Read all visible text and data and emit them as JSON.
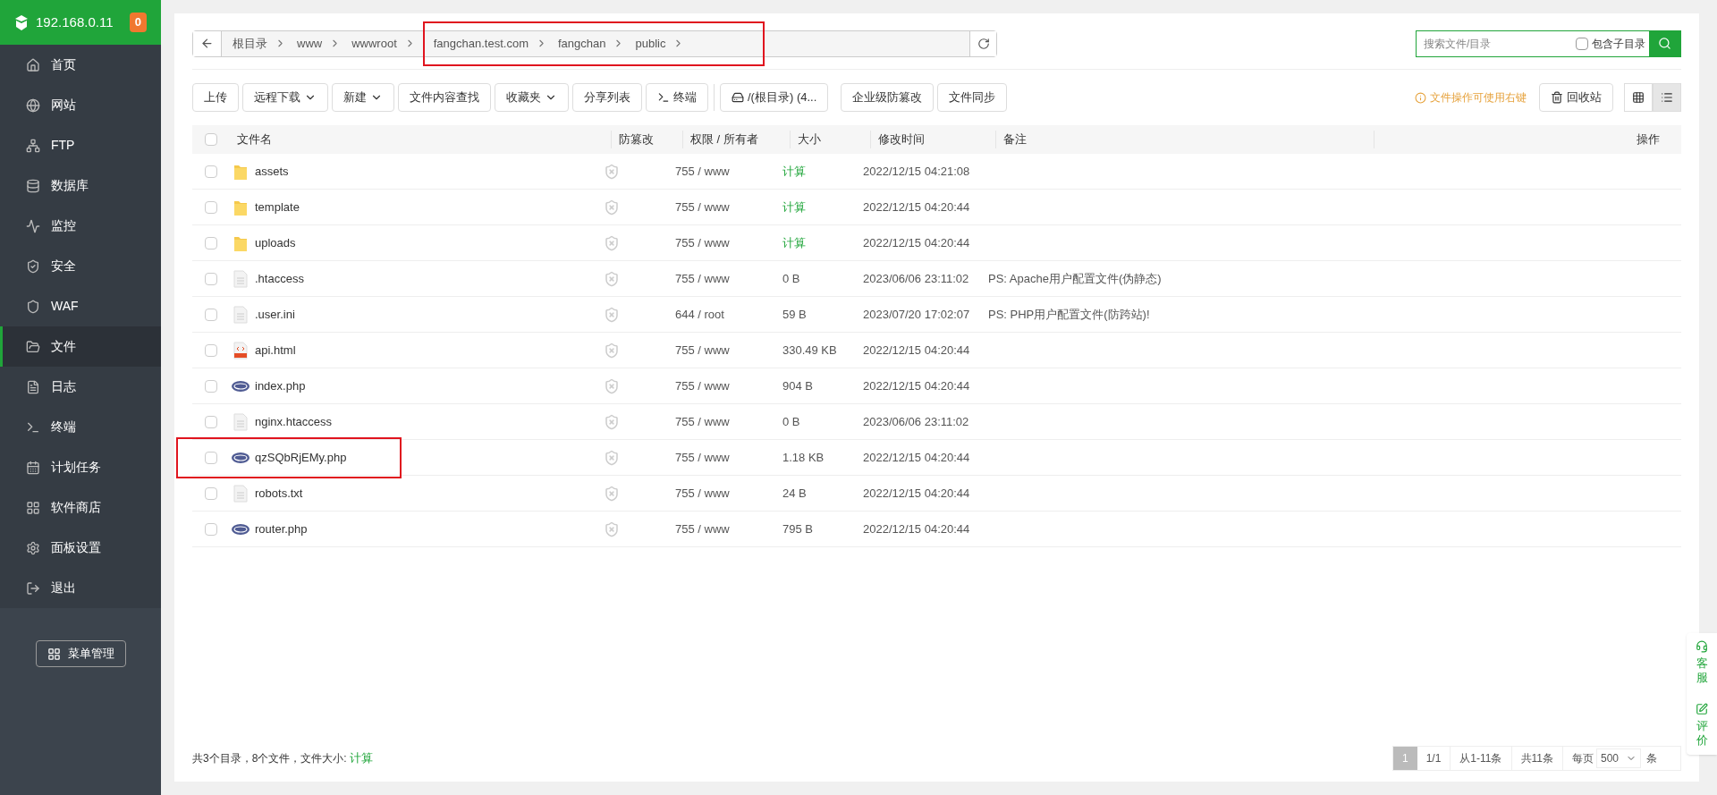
{
  "sidebar": {
    "host": "192.168.0.11",
    "badge": "0",
    "items": [
      {
        "label": "首页",
        "selected": false
      },
      {
        "label": "网站",
        "selected": false
      },
      {
        "label": "FTP",
        "selected": false
      },
      {
        "label": "数据库",
        "selected": false
      },
      {
        "label": "监控",
        "selected": false
      },
      {
        "label": "安全",
        "selected": false
      },
      {
        "label": "WAF",
        "selected": false
      },
      {
        "label": "文件",
        "selected": true
      },
      {
        "label": "日志",
        "selected": false
      },
      {
        "label": "终端",
        "selected": false
      },
      {
        "label": "计划任务",
        "selected": false
      },
      {
        "label": "软件商店",
        "selected": false
      },
      {
        "label": "面板设置",
        "selected": false
      },
      {
        "label": "退出",
        "selected": false
      }
    ],
    "menu_button": "菜单管理"
  },
  "breadcrumb": [
    {
      "label": "根目录",
      "highlighted": false
    },
    {
      "label": "www",
      "highlighted": false
    },
    {
      "label": "wwwroot",
      "highlighted": false
    },
    {
      "label": "fangchan.test.com",
      "highlighted": true
    },
    {
      "label": "fangchan",
      "highlighted": true
    },
    {
      "label": "public",
      "highlighted": true
    }
  ],
  "search": {
    "placeholder": "搜索文件/目录",
    "subdir_label": "包含子目录",
    "subdir_checked": false
  },
  "toolbar": [
    {
      "label": "上传",
      "kind": "plain"
    },
    {
      "label": "远程下载",
      "kind": "dropdown"
    },
    {
      "label": "新建",
      "kind": "dropdown"
    },
    {
      "label": "文件内容查找",
      "kind": "plain"
    },
    {
      "label": "收藏夹",
      "kind": "dropdown"
    },
    {
      "label": "分享列表",
      "kind": "plain"
    },
    {
      "label": "终端",
      "kind": "terminal"
    },
    {
      "label": "/(根目录) (4...",
      "kind": "disk"
    },
    {
      "label": "企业级防篡改",
      "kind": "plain"
    },
    {
      "label": "文件同步",
      "kind": "plain"
    }
  ],
  "hint": "文件操作可使用右键",
  "recycle": "回收站",
  "view_modes": [
    {
      "kind": "grid",
      "selected": false
    },
    {
      "kind": "list",
      "selected": true
    }
  ],
  "table": {
    "all_checked": false,
    "columns": [
      "文件名",
      "防篡改",
      "权限 / 所有者",
      "大小",
      "修改时间",
      "备注",
      "操作"
    ],
    "rows": [
      {
        "kind": "folder",
        "name": "assets",
        "perm": "755 / www",
        "size": "计算",
        "size_link": true,
        "mtime": "2022/12/15 04:21:08",
        "checked": false,
        "highlighted": false
      },
      {
        "kind": "folder",
        "name": "template",
        "perm": "755 / www",
        "size": "计算",
        "size_link": true,
        "mtime": "2022/12/15 04:20:44",
        "checked": false,
        "highlighted": false
      },
      {
        "kind": "folder",
        "name": "uploads",
        "perm": "755 / www",
        "size": "计算",
        "size_link": true,
        "mtime": "2022/12/15 04:20:44",
        "checked": false,
        "highlighted": false
      },
      {
        "kind": "file",
        "name": ".htaccess",
        "perm": "755 / www",
        "size": "0 B",
        "size_link": false,
        "mtime": "2023/06/06 23:11:02",
        "note": "PS: Apache用户配置文件(伪静态)",
        "checked": false,
        "highlighted": false
      },
      {
        "kind": "file",
        "name": ".user.ini",
        "perm": "644 / root",
        "size": "59 B",
        "size_link": false,
        "mtime": "2023/07/20 17:02:07",
        "note": "PS: PHP用户配置文件(防跨站)!",
        "checked": false,
        "highlighted": false
      },
      {
        "kind": "html",
        "name": "api.html",
        "perm": "755 / www",
        "size": "330.49 KB",
        "size_link": false,
        "mtime": "2022/12/15 04:20:44",
        "checked": false,
        "highlighted": false
      },
      {
        "kind": "php",
        "name": "index.php",
        "perm": "755 / www",
        "size": "904 B",
        "size_link": false,
        "mtime": "2022/12/15 04:20:44",
        "checked": false,
        "highlighted": false
      },
      {
        "kind": "file",
        "name": "nginx.htaccess",
        "perm": "755 / www",
        "size": "0 B",
        "size_link": false,
        "mtime": "2023/06/06 23:11:02",
        "checked": false,
        "highlighted": false
      },
      {
        "kind": "php",
        "name": "qzSQbRjEMy.php",
        "perm": "755 / www",
        "size": "1.18 KB",
        "size_link": false,
        "mtime": "2022/12/15 04:20:44",
        "checked": false,
        "highlighted": true
      },
      {
        "kind": "file",
        "name": "robots.txt",
        "perm": "755 / www",
        "size": "24 B",
        "size_link": false,
        "mtime": "2022/12/15 04:20:44",
        "checked": false,
        "highlighted": false
      },
      {
        "kind": "php",
        "name": "router.php",
        "perm": "755 / www",
        "size": "795 B",
        "size_link": false,
        "mtime": "2022/12/15 04:20:44",
        "checked": false,
        "highlighted": false
      }
    ]
  },
  "summary": {
    "text": "共3个目录，8个文件，文件大小:",
    "link": "计算"
  },
  "pagination": {
    "current": "1",
    "pages": "1/1",
    "range": "从1-11条",
    "total": "共11条",
    "per_page_label": "每页",
    "per_page": "500",
    "unit": "条"
  },
  "float": [
    {
      "kind": "service",
      "label": "客服"
    },
    {
      "kind": "review",
      "label": "评价"
    }
  ]
}
